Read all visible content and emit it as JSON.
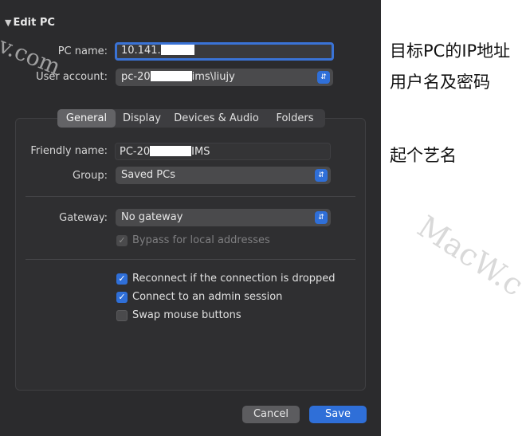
{
  "window": {
    "title": "Edit PC"
  },
  "watermark_left": "v.com",
  "pc_name": {
    "label": "PC name:",
    "value": "10.141."
  },
  "user_account": {
    "label": "User account:",
    "value_prefix": "pc-20",
    "value_suffix": "ims\\liujy"
  },
  "tabs": [
    "General",
    "Display",
    "Devices & Audio",
    "Folders"
  ],
  "selected_tab": "General",
  "general": {
    "friendly_name": {
      "label": "Friendly name:",
      "value_prefix": "PC-20",
      "value_suffix": "IMS"
    },
    "group": {
      "label": "Group:",
      "value": "Saved PCs"
    },
    "gateway": {
      "label": "Gateway:",
      "value": "No gateway"
    },
    "bypass": {
      "label": "Bypass for local addresses",
      "checked": true,
      "disabled": true
    },
    "reconnect": {
      "label": "Reconnect if the connection is dropped",
      "checked": true
    },
    "admin_session": {
      "label": "Connect to an admin session",
      "checked": true
    },
    "swap_mouse": {
      "label": "Swap mouse buttons",
      "checked": false
    }
  },
  "buttons": {
    "cancel": "Cancel",
    "save": "Save"
  },
  "annotations": {
    "ip": "目标PC的IP地址",
    "user": "用户名及密码",
    "name": "起个艺名"
  },
  "watermark_right": "MacW.c",
  "colors": {
    "accent": "#2f6fd8",
    "window_bg": "#2b2b2d",
    "redaction": "#ffffff"
  }
}
